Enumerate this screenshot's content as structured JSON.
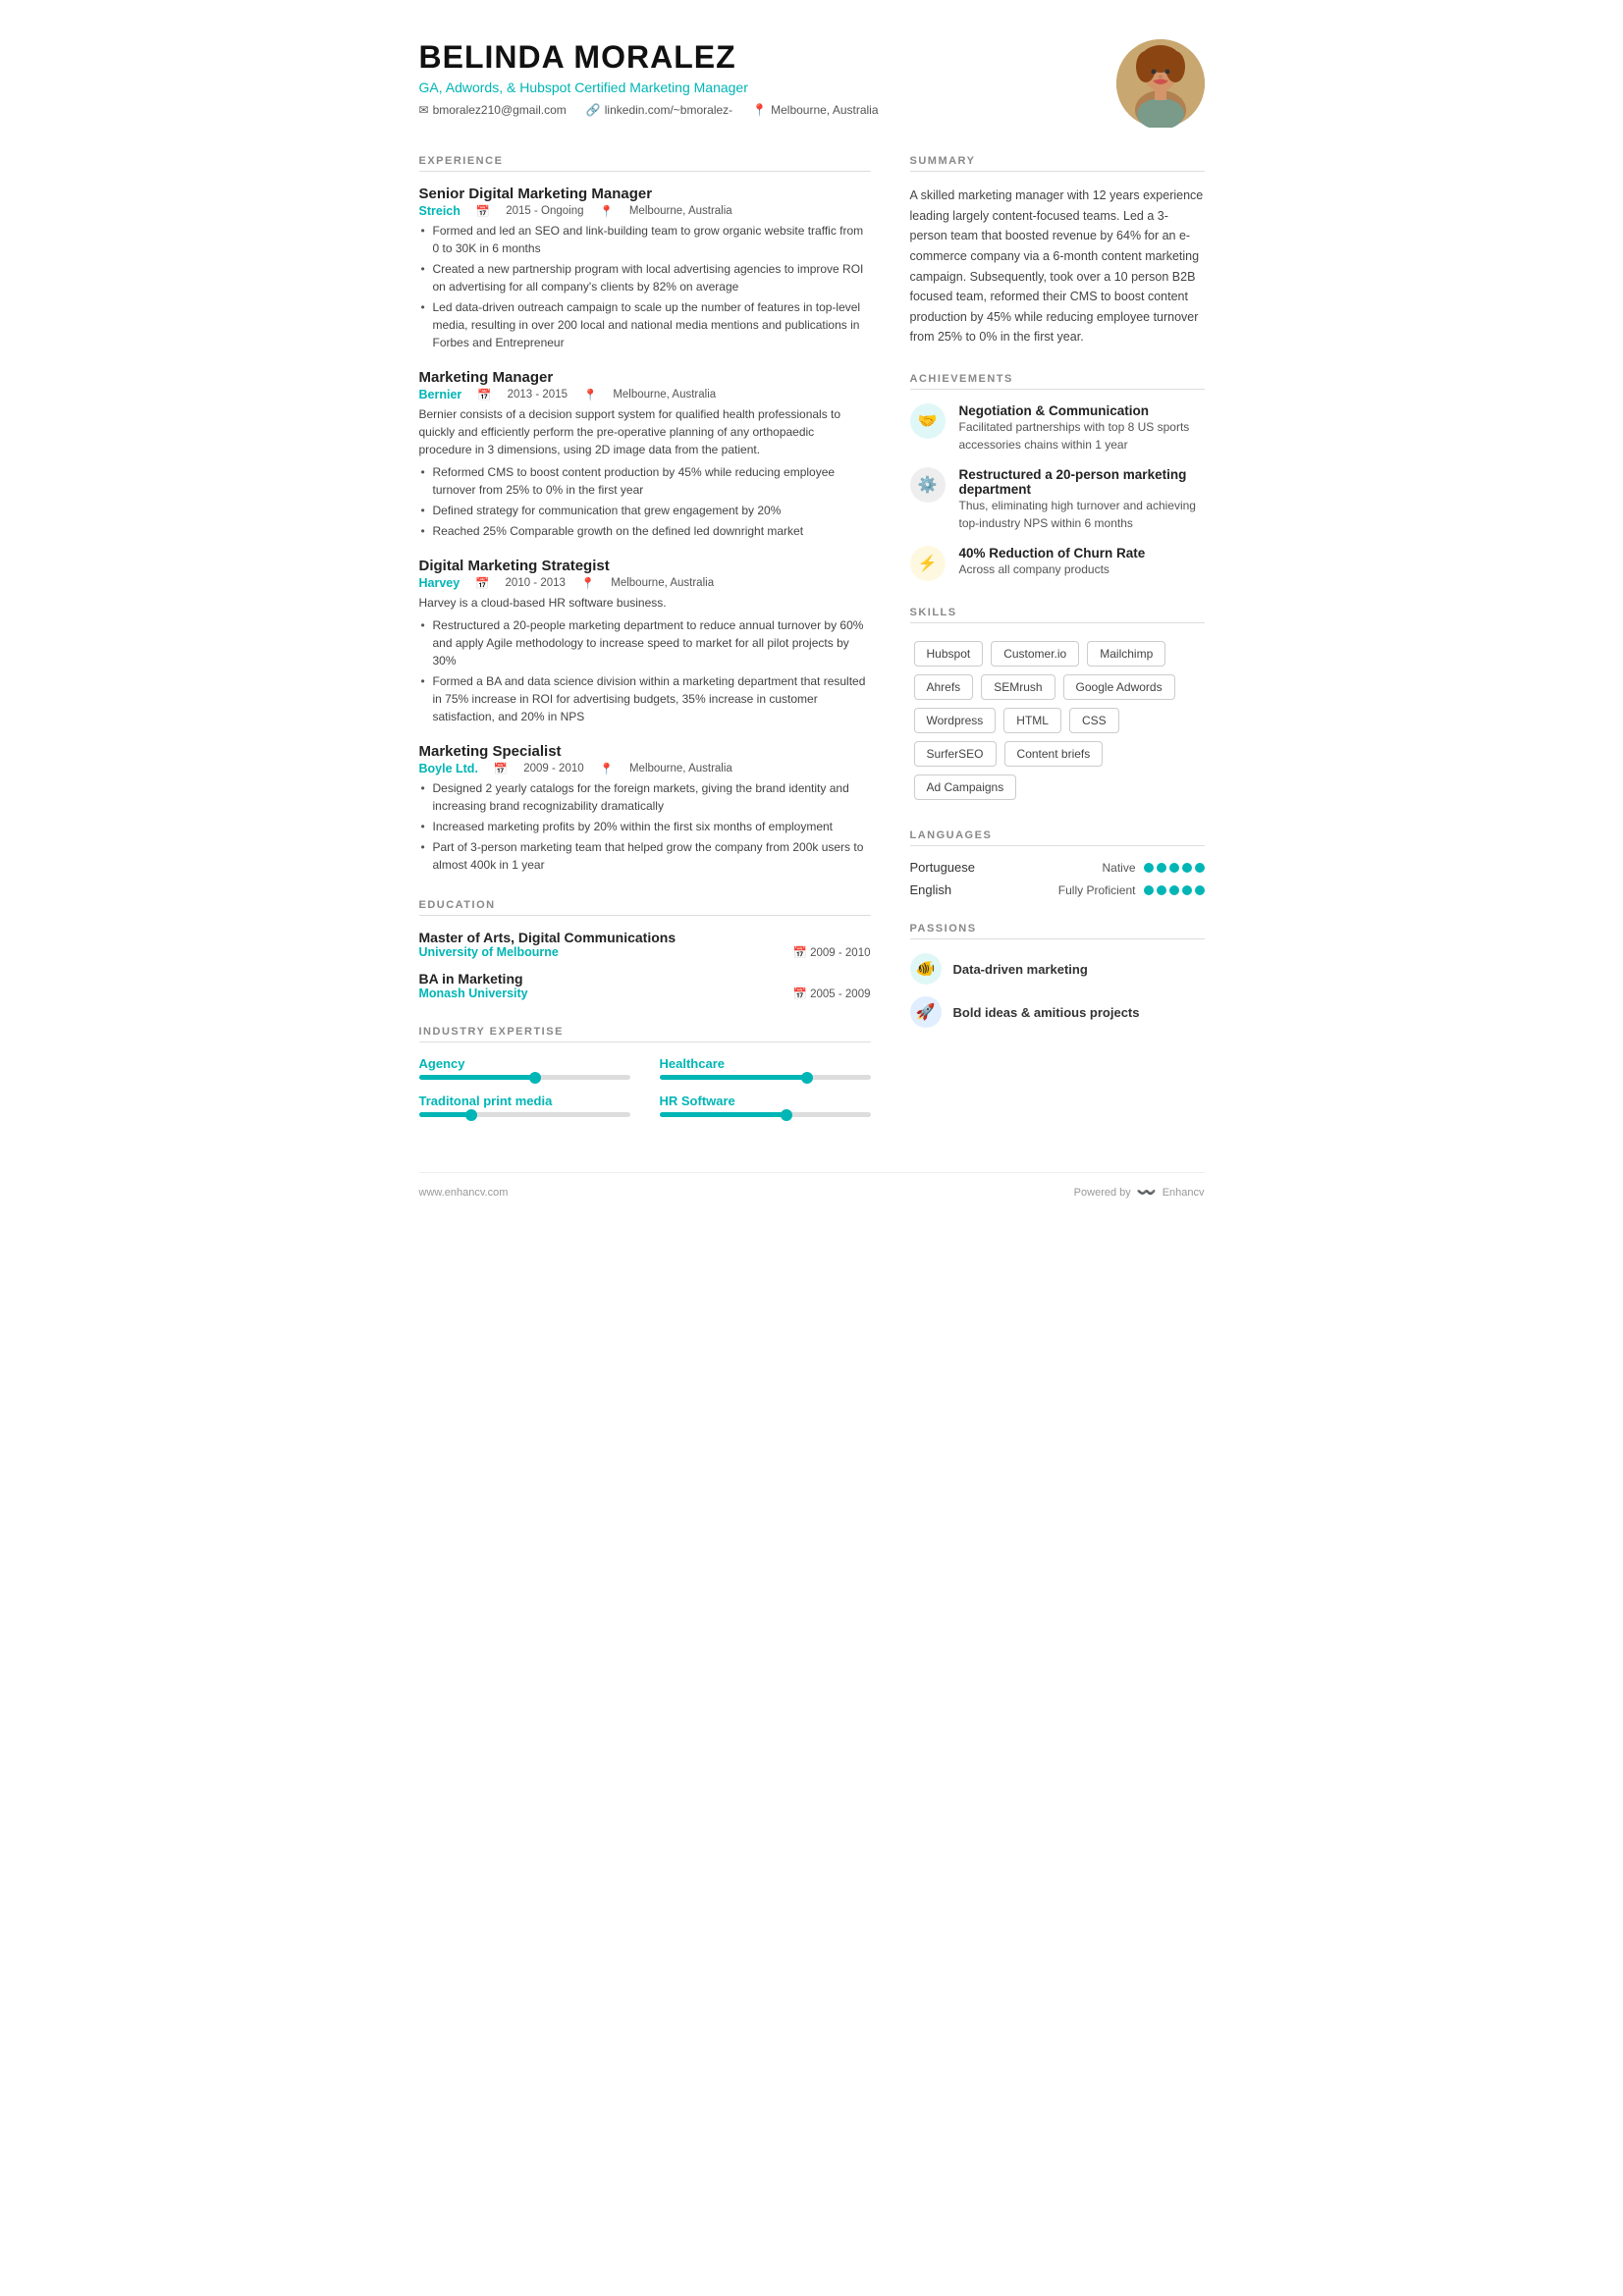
{
  "header": {
    "name": "BELINDA MORALEZ",
    "title": "GA, Adwords, & Hubspot Certified Marketing Manager",
    "email": "bmoralez210@gmail.com",
    "linkedin": "linkedin.com/~bmoralez-",
    "location": "Melbourne, Australia"
  },
  "sections": {
    "experience_label": "EXPERIENCE",
    "summary_label": "SUMMARY",
    "achievements_label": "ACHIEVEMENTS",
    "skills_label": "SKILLS",
    "education_label": "EDUCATION",
    "expertise_label": "INDUSTRY EXPERTISE",
    "languages_label": "LANGUAGES",
    "passions_label": "PASSIONS"
  },
  "experience": [
    {
      "title": "Senior Digital Marketing Manager",
      "company": "Streich",
      "dates": "2015 - Ongoing",
      "location": "Melbourne, Australia",
      "desc": "",
      "bullets": [
        "Formed and led an SEO and link-building team to grow organic website traffic from 0 to 30K in 6 months",
        "Created a new partnership program with local advertising agencies to improve ROI on advertising for all company's clients by 82% on average",
        "Led data-driven outreach campaign to scale up the number of features in top-level media, resulting in over 200 local and national media mentions and publications in Forbes and Entrepreneur"
      ]
    },
    {
      "title": "Marketing Manager",
      "company": "Bernier",
      "dates": "2013 - 2015",
      "location": "Melbourne, Australia",
      "desc": "Bernier consists of a decision support system for qualified health professionals to quickly and efficiently perform the pre-operative planning of any orthopaedic procedure in 3 dimensions, using 2D image data from the patient.",
      "bullets": [
        "Reformed CMS to boost content production by 45% while reducing employee turnover from 25% to 0% in the first year",
        "Defined strategy for communication that grew engagement by 20%",
        "Reached 25% Comparable growth on the defined led downright market"
      ]
    },
    {
      "title": "Digital Marketing Strategist",
      "company": "Harvey",
      "dates": "2010 - 2013",
      "location": "Melbourne, Australia",
      "desc": "Harvey is a cloud-based HR software business.",
      "bullets": [
        "Restructured a 20-people marketing department to reduce annual turnover by 60% and apply Agile methodology to increase speed to market for all pilot projects by 30%",
        "Formed a BA and data science division within a marketing department that resulted in 75% increase in ROI for advertising budgets, 35% increase in customer satisfaction, and 20% in NPS"
      ]
    },
    {
      "title": "Marketing Specialist",
      "company": "Boyle Ltd.",
      "dates": "2009 - 2010",
      "location": "Melbourne, Australia",
      "desc": "",
      "bullets": [
        "Designed 2 yearly catalogs for the foreign markets, giving the brand identity and increasing brand recognizability dramatically",
        "Increased marketing profits by 20% within the first six months of employment",
        "Part of 3-person marketing team that helped grow the company from 200k users to almost 400k in 1 year"
      ]
    }
  ],
  "education": [
    {
      "degree": "Master of Arts, Digital Communications",
      "school": "University of Melbourne",
      "dates": "2009 - 2010"
    },
    {
      "degree": "BA in Marketing",
      "school": "Monash University",
      "dates": "2005 - 2009"
    }
  ],
  "expertise": [
    {
      "label": "Agency",
      "fill": 55,
      "dot": 55
    },
    {
      "label": "Healthcare",
      "fill": 70,
      "dot": 70
    },
    {
      "label": "Traditonal print media",
      "fill": 25,
      "dot": 25
    },
    {
      "label": "HR Software",
      "fill": 60,
      "dot": 60
    }
  ],
  "summary": "A skilled marketing manager with 12 years experience leading largely content-focused teams. Led a 3-person team that boosted revenue by 64% for an e-commerce company via a 6-month content marketing campaign. Subsequently, took over a 10 person B2B focused team, reformed their CMS to boost content production by 45% while reducing employee turnover from 25% to 0% in the first year.",
  "achievements": [
    {
      "icon": "🤝",
      "icon_class": "teal",
      "title": "Negotiation & Communication",
      "desc": "Facilitated partnerships with top 8 US sports accessories chains within 1 year"
    },
    {
      "icon": "⚙️",
      "icon_class": "gray",
      "title": "Restructured a 20-person marketing department",
      "desc": "Thus, eliminating high turnover and achieving top-industry NPS within 6 months"
    },
    {
      "icon": "⚡",
      "icon_class": "yellow",
      "title": "40% Reduction of Churn Rate",
      "desc": "Across all company products"
    }
  ],
  "skills": [
    "Hubspot",
    "Customer.io",
    "Mailchimp",
    "Ahrefs",
    "SEMrush",
    "Google Adwords",
    "Wordpress",
    "HTML",
    "CSS",
    "SurferSEO",
    "Content briefs",
    "Ad Campaigns"
  ],
  "languages": [
    {
      "name": "Portuguese",
      "level": "Native",
      "dots": 5,
      "filled": 5
    },
    {
      "name": "English",
      "level": "Fully Proficient",
      "dots": 5,
      "filled": 5
    }
  ],
  "passions": [
    {
      "icon": "🐠",
      "icon_class": "teal",
      "label": "Data-driven marketing"
    },
    {
      "icon": "🚀",
      "icon_class": "blue",
      "label": "Bold ideas & amitious projects"
    }
  ],
  "footer": {
    "left": "www.enhancv.com",
    "powered_by": "Powered by",
    "brand": "Enhancv"
  }
}
